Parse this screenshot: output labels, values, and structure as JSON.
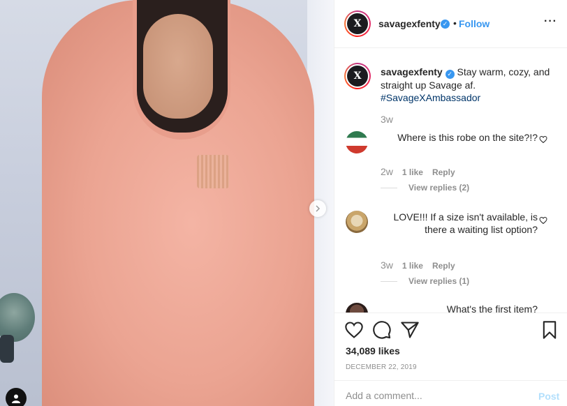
{
  "post": {
    "username": "savagexfenty",
    "follow_separator": "•",
    "follow_label": "Follow",
    "more_label": "···",
    "avatar_letter": "X"
  },
  "caption": {
    "username": "savagexfenty",
    "text": "Stay warm, cozy, and straight up Savage af.",
    "hashtag": "#SavageXAmbassador",
    "age": "3w"
  },
  "comments": [
    {
      "username": "",
      "text": "Where is this robe on the site?!?",
      "age": "2w",
      "likes": "1 like",
      "reply_label": "Reply",
      "view_replies": "View replies (2)",
      "avatar_colors": [
        "#2f7a4f",
        "#ffffff",
        "#cf3a2e"
      ]
    },
    {
      "username": "",
      "text": "LOVE!!! If a size isn't available, is there a waiting list option?",
      "age": "3w",
      "likes": "1 like",
      "reply_label": "Reply",
      "view_replies": "View replies (1)",
      "avatar_colors": [
        "#e8d7b6",
        "#c9a56a",
        "#8a6a3e"
      ]
    },
    {
      "username": "",
      "text": "What's the first item?",
      "avatar_colors": [
        "#5a3a30",
        "#2b1d1a",
        "#6e4b3f"
      ]
    }
  ],
  "footer": {
    "likes": "34,089 likes",
    "date": "DECEMBER 22, 2019",
    "comment_placeholder": "Add a comment...",
    "post_label": "Post"
  },
  "icons": {
    "heart": "heart-icon",
    "comment": "comment-icon",
    "share": "share-icon",
    "save": "bookmark-icon",
    "carousel_next": "chevron-right-icon",
    "tagged_user": "user-tag-icon"
  },
  "colors": {
    "accent": "#3897f0",
    "text": "#262626",
    "muted": "#8e8e8e",
    "post_disabled": "#b2dffc"
  }
}
